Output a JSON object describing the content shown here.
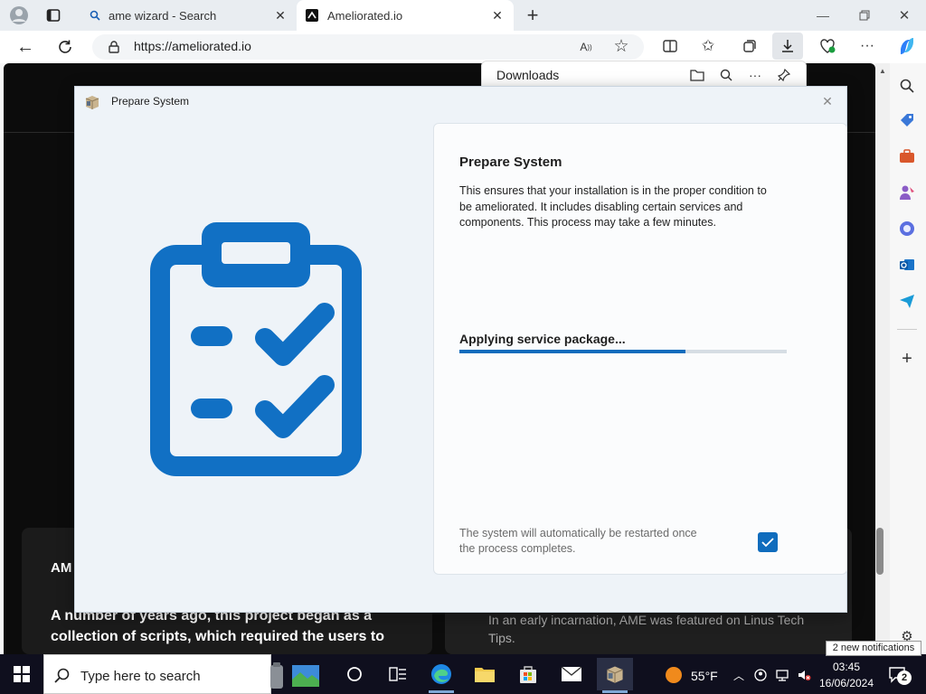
{
  "browser": {
    "tabs": [
      {
        "label": "ame wizard - Search",
        "icon": "search-icon"
      },
      {
        "label": "Ameliorated.io",
        "icon": "ameliorated-logo-icon",
        "active": true
      }
    ],
    "url": "https://ameliorated.io",
    "downloads_title": "Downloads"
  },
  "webpage": {
    "heading_partial": "AM",
    "para1": "A number of years ago, this project began as a collection of scripts, which required the users to",
    "caption": "In an early incarnation, AME was featured on Linus Tech Tips."
  },
  "dialog": {
    "window_title": "Prepare System",
    "title": "Prepare System",
    "description": "This ensures that your installation is in the proper condition to be ameliorated. It includes disabling certain services and components. This process may take a few minutes.",
    "status": "Applying service package...",
    "progress": 0.69,
    "restart_note": "The system will automatically be restarted once the process completes.",
    "restart_checked": true
  },
  "taskbar": {
    "search_placeholder": "Type here to search",
    "weather": "55°F",
    "time": "03:45",
    "date": "16/06/2024",
    "notification_count": "2",
    "notification_toast": "2 new notifications"
  },
  "colors": {
    "accent": "#0f6cbd",
    "clipboard": "#1170c4"
  }
}
